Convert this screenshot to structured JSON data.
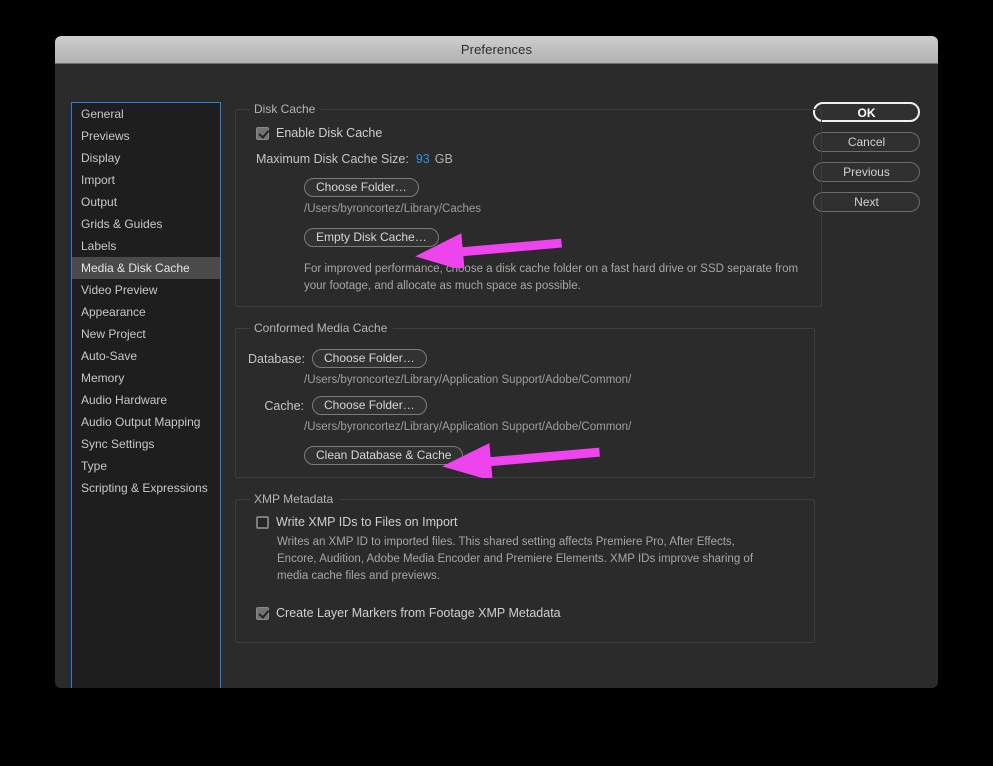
{
  "window": {
    "title": "Preferences"
  },
  "sidebar": {
    "items": [
      {
        "label": "General",
        "selected": false
      },
      {
        "label": "Previews",
        "selected": false
      },
      {
        "label": "Display",
        "selected": false
      },
      {
        "label": "Import",
        "selected": false
      },
      {
        "label": "Output",
        "selected": false
      },
      {
        "label": "Grids & Guides",
        "selected": false
      },
      {
        "label": "Labels",
        "selected": false
      },
      {
        "label": "Media & Disk Cache",
        "selected": true
      },
      {
        "label": "Video Preview",
        "selected": false
      },
      {
        "label": "Appearance",
        "selected": false
      },
      {
        "label": "New Project",
        "selected": false
      },
      {
        "label": "Auto-Save",
        "selected": false
      },
      {
        "label": "Memory",
        "selected": false
      },
      {
        "label": "Audio Hardware",
        "selected": false
      },
      {
        "label": "Audio Output Mapping",
        "selected": false
      },
      {
        "label": "Sync Settings",
        "selected": false
      },
      {
        "label": "Type",
        "selected": false
      },
      {
        "label": "Scripting & Expressions",
        "selected": false
      }
    ]
  },
  "buttons": {
    "ok": "OK",
    "cancel": "Cancel",
    "previous": "Previous",
    "next": "Next"
  },
  "disk_cache": {
    "legend": "Disk Cache",
    "enable_label": "Enable Disk Cache",
    "enable_checked": true,
    "max_size_label": "Maximum Disk Cache Size:",
    "max_size_value": "93",
    "max_size_unit": "GB",
    "choose_folder_label": "Choose Folder…",
    "path": "/Users/byroncortez/Library/Caches",
    "empty_cache_label": "Empty Disk Cache…",
    "help": "For improved performance, choose a disk cache folder on a fast hard drive or SSD separate from your footage, and allocate as much space as possible."
  },
  "conformed_media_cache": {
    "legend": "Conformed Media Cache",
    "database_label": "Database:",
    "database_button": "Choose Folder…",
    "database_path": "/Users/byroncortez/Library/Application Support/Adobe/Common/",
    "cache_label": "Cache:",
    "cache_button": "Choose Folder…",
    "cache_path": "/Users/byroncortez/Library/Application Support/Adobe/Common/",
    "clean_button": "Clean Database & Cache"
  },
  "xmp_metadata": {
    "legend": "XMP Metadata",
    "write_ids_label": "Write XMP IDs to Files on Import",
    "write_ids_checked": false,
    "write_ids_help": "Writes an XMP ID to imported files. This shared setting affects Premiere Pro, After Effects, Encore, Audition, Adobe Media Encoder and Premiere Elements. XMP IDs improve sharing of media cache files and previews.",
    "create_markers_label": "Create Layer Markers from Footage XMP Metadata",
    "create_markers_checked": true
  },
  "annotations": {
    "arrow_color": "#ee44ee",
    "arrow_1_target": "Empty Disk Cache…",
    "arrow_2_target": "Clean Database & Cache"
  }
}
